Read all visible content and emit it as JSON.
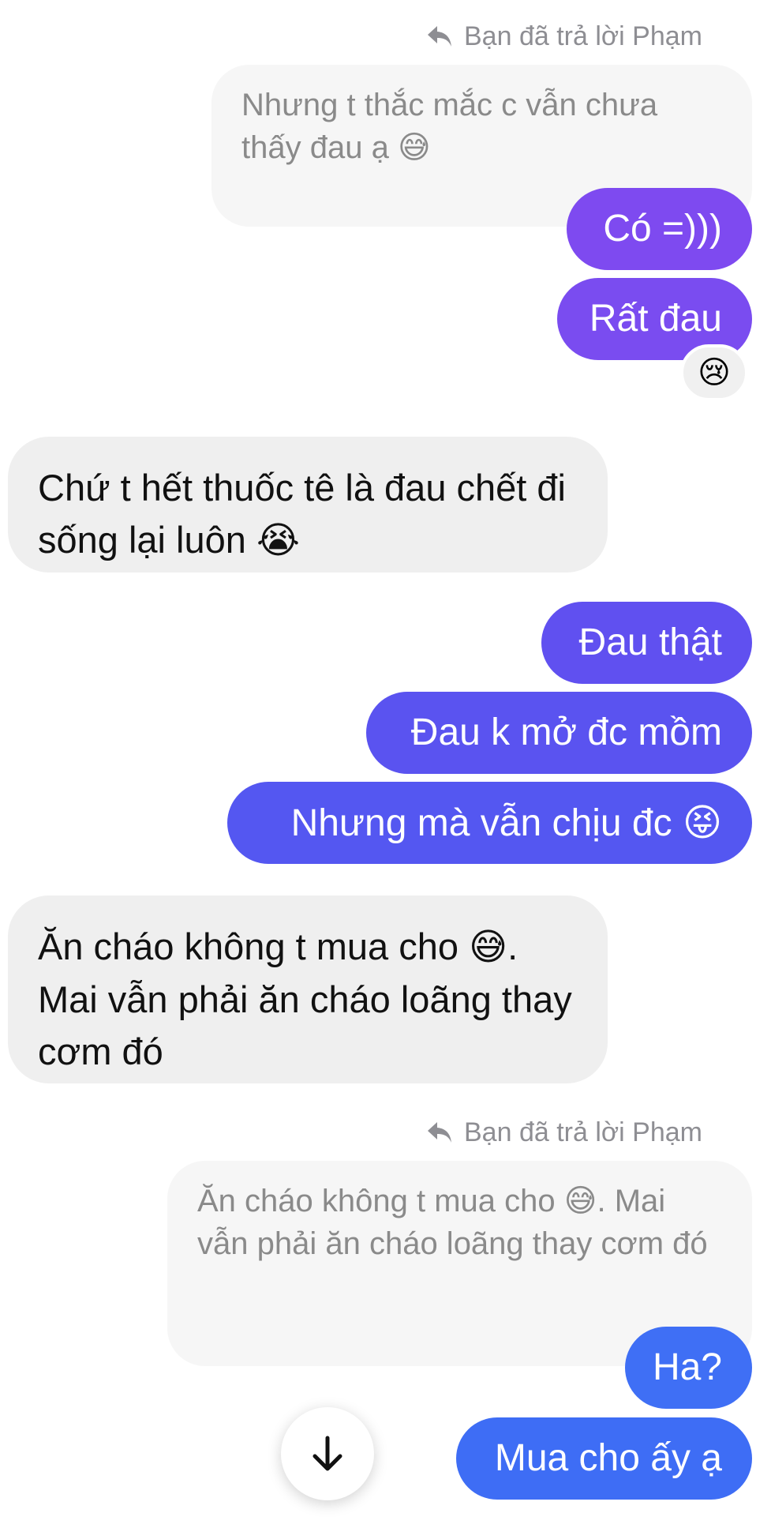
{
  "colors": {
    "outgoing_purple": "#7e4af0",
    "outgoing_indigo": "#5a55f0",
    "outgoing_blue": "#3f6ff5",
    "incoming": "#efefef",
    "quoted": "#f6f6f6"
  },
  "messages": {
    "reply_note_1": "Bạn đã trả lời Phạm",
    "quoted_1": "Nhưng t thắc mắc c vẫn chưa thấy đau ạ",
    "quoted_1_emoji": "😅",
    "out_1": "Có =)))",
    "out_2": "Rất đau",
    "reaction_1": "😢",
    "in_1": "Chứ t hết thuốc tê là đau chết đi sống lại luôn",
    "in_1_emoji": "😭",
    "out_3": "Đau thật",
    "out_4": "Đau k mở đc mồm",
    "out_5": "Nhưng mà vẫn chịu đc",
    "out_5_emoji": "😝",
    "in_2_part1": "Ăn cháo không t mua cho",
    "in_2_emoji": "😅",
    "in_2_part2": ". Mai vẫn phải ăn cháo loãng thay cơm đó",
    "reply_note_2": "Bạn đã trả lời Phạm",
    "quoted_2_part1": "Ăn cháo không t mua cho",
    "quoted_2_emoji": "😅",
    "quoted_2_part2": ". Mai vẫn phải ăn cháo loãng thay cơm đó",
    "out_6": "Ha?",
    "out_7": "Mua cho ấy ạ"
  },
  "icons": {
    "reply": "reply-arrow-icon",
    "scroll_down": "arrow-down-icon"
  }
}
